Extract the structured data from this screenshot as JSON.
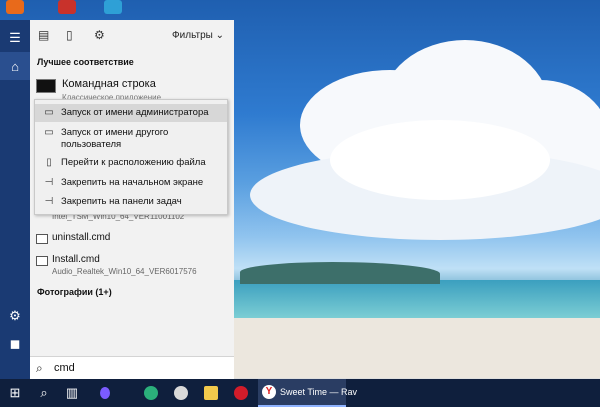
{
  "search": {
    "filters_label": "Фильтры",
    "best_match_header": "Лучшее соответствие",
    "query": "cmd",
    "best_match": {
      "title": "Командная строка",
      "subtitle": "Классическое приложение"
    },
    "results": [
      {
        "name": "Intel_TSM_Win10_64_VER11001102",
        "icon": "file-icon"
      },
      {
        "name": "uninstall.cmd",
        "icon": "file-icon"
      },
      {
        "name": "Install.cmd",
        "subtitle": "Audio_Realtek_Win10_64_VER6017576",
        "icon": "file-icon"
      }
    ],
    "photos_header": "Фотографии (1+)"
  },
  "context_menu": {
    "items": [
      {
        "label": "Запуск от имени администратора",
        "icon": "admin-icon",
        "active": true
      },
      {
        "label": "Запуск от имени другого пользователя",
        "icon": "user-icon",
        "active": false
      },
      {
        "label": "Перейти к расположению файла",
        "icon": "folder-icon",
        "active": false
      },
      {
        "label": "Закрепить на начальном экране",
        "icon": "pin-icon",
        "active": false
      },
      {
        "label": "Закрепить на панели задач",
        "icon": "pin-icon",
        "active": false
      }
    ]
  },
  "taskbar": {
    "yandex_title": "Sweet Time — Rav"
  },
  "colors": {
    "taskbar": "#0f1f3d",
    "rail": "#1a3a73",
    "panel": "#f2f2f2",
    "menu_active": "#d7d7d7"
  }
}
